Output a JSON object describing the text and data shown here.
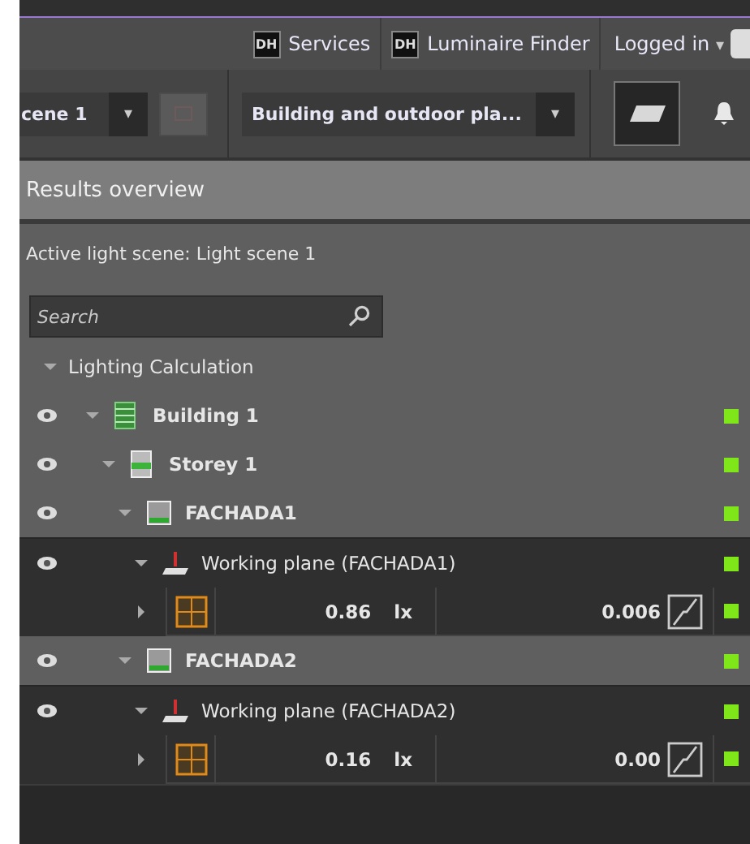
{
  "top_bar": {
    "links": [
      {
        "logo": "DH",
        "label": "Services"
      },
      {
        "logo": "DH",
        "label": "Luminaire Finder"
      }
    ],
    "account": {
      "label": "Logged in",
      "caret": "▾"
    }
  },
  "toolbar": {
    "scene_dropdown": {
      "value": "cene 1",
      "caret": "▾"
    },
    "view_dropdown": {
      "value": "Building and outdoor pla...",
      "caret": "▾"
    }
  },
  "panel": {
    "title": "Results overview",
    "active_scene": "Active light scene: Light scene 1",
    "search": {
      "placeholder": "Search"
    },
    "tree": {
      "label": "Lighting Calculation",
      "expanded": true,
      "children": [
        {
          "kind": "building",
          "label": "Building 1",
          "expanded": true,
          "children": [
            {
              "kind": "storey",
              "label": "Storey 1",
              "expanded": true,
              "children": [
                {
                  "kind": "room",
                  "label": "FACHADA1",
                  "expanded": true,
                  "children": [
                    {
                      "kind": "plane",
                      "label": "Working plane (FACHADA1)",
                      "expanded": true,
                      "children": [
                        {
                          "kind": "result",
                          "value": "0.86",
                          "unit": "lx",
                          "ratio": "0.006",
                          "expanded": false
                        }
                      ]
                    }
                  ]
                },
                {
                  "kind": "room",
                  "label": "FACHADA2",
                  "expanded": true,
                  "children": [
                    {
                      "kind": "plane",
                      "label": "Working plane (FACHADA2)",
                      "expanded": true,
                      "children": [
                        {
                          "kind": "result",
                          "value": "0.16",
                          "unit": "lx",
                          "ratio": "0.00",
                          "expanded": false
                        }
                      ]
                    }
                  ]
                }
              ]
            }
          ]
        }
      ]
    }
  }
}
